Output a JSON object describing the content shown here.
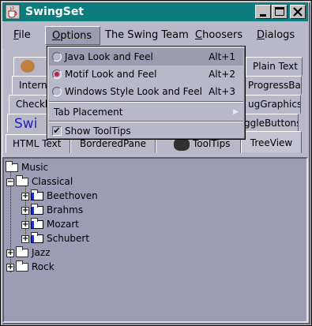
{
  "window": {
    "title": "SwingSet",
    "controls": {
      "minimize": "_",
      "maximize": "□",
      "close": "✕"
    }
  },
  "menubar": [
    {
      "label": "File",
      "mnemonic": "F",
      "rest": "ile"
    },
    {
      "label": "Options",
      "mnemonic": "O",
      "rest": "ptions"
    },
    {
      "label": "The Swing Team",
      "mnemonic": "",
      "rest": "The Swing Team"
    },
    {
      "label": "Choosers",
      "mnemonic": "C",
      "rest": "hoosers"
    },
    {
      "label": "Dialogs",
      "mnemonic": "D",
      "rest": "ialogs"
    }
  ],
  "options_menu": {
    "items": [
      {
        "type": "radio",
        "label": "Java Look and Feel",
        "accel": "Alt+1",
        "selected": false,
        "highlighted": true
      },
      {
        "type": "radio",
        "label": "Motif Look and Feel",
        "accel": "Alt+2",
        "selected": true,
        "highlighted": false
      },
      {
        "type": "radio",
        "label": "Windows Style Look and Feel",
        "accel": "Alt+3",
        "selected": false,
        "highlighted": false
      },
      {
        "type": "submenu",
        "label": "Tab Placement"
      },
      {
        "type": "check",
        "label": "Show ToolTips",
        "checked": true
      }
    ]
  },
  "tabs": {
    "row1": [
      "Plain Text"
    ],
    "row2": [
      "Intern",
      "ProgressBar"
    ],
    "row3": [
      "Checkb",
      "ugGraphics"
    ],
    "row4": [
      "Swi",
      "ggleButtons"
    ],
    "row5": [
      "HTML Text",
      "BorderedPane",
      "ToolTips",
      "TreeView"
    ],
    "selected": "TreeView"
  },
  "tree": {
    "root": "Music",
    "children": [
      {
        "label": "Classical",
        "expanded": true,
        "children": [
          "Beethoven",
          "Brahms",
          "Mozart",
          "Schubert"
        ]
      },
      {
        "label": "Jazz",
        "expanded": false
      },
      {
        "label": "Rock",
        "expanded": false
      }
    ]
  }
}
